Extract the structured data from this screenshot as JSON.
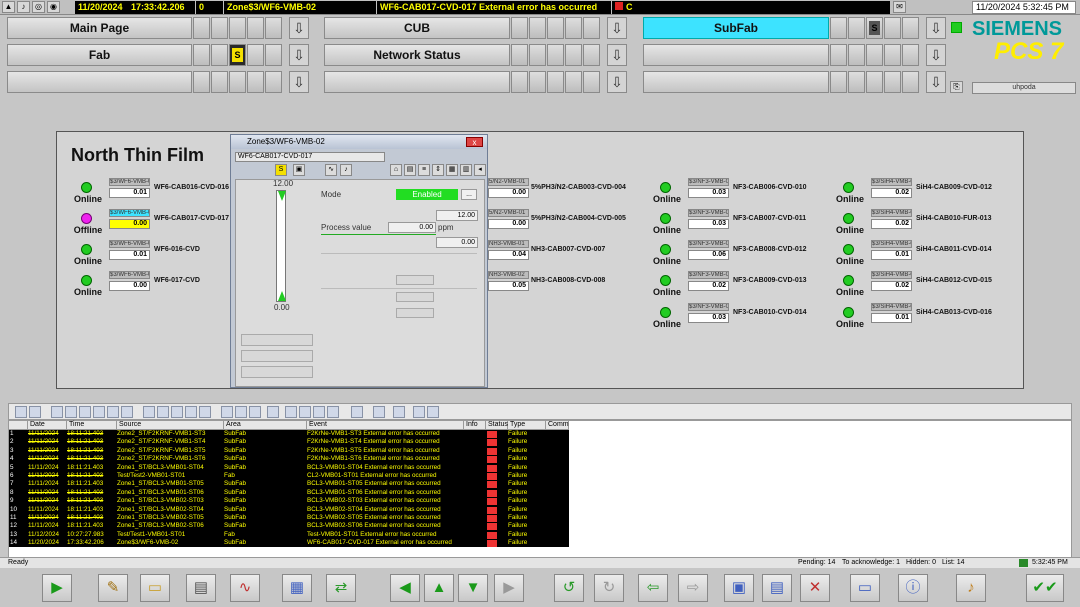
{
  "topbar": {
    "date": "11/20/2024",
    "time": "17:33:42.206",
    "count": "0",
    "source": "Zone$3/WF6-VMB-02",
    "message": "WF6-CAB017-CVD-017 External error has occurred",
    "class": "C",
    "datetime": "11/20/2024 5:32:45 PM"
  },
  "areas": {
    "main_page": "Main Page",
    "cub": "CUB",
    "subfab": "SubFab",
    "fab": "Fab",
    "network_status": "Network Status",
    "s_label": "S"
  },
  "brand": {
    "siemens": "SIEMENS",
    "pcs7": "PCS 7",
    "user": "uhpoda"
  },
  "picture": {
    "title": "North Thin Film",
    "col1": [
      {
        "state": "Online",
        "tag": "$3/WF6-VMB-0",
        "value": "0.01",
        "name": "WF6-CAB016-CVD-016",
        "led": "green"
      },
      {
        "state": "Offline",
        "tag": "$3/WF6-VMB-0",
        "value": "0.00",
        "name": "WF6-CAB017-CVD-017",
        "led": "magenta"
      },
      {
        "state": "Online",
        "tag": "$3/WF6-VMB-0",
        "value": "0.01",
        "name": "WF6-016-CVD",
        "led": "green"
      },
      {
        "state": "Online",
        "tag": "$3/WF6-VMB-0",
        "value": "0.00",
        "name": "WF6-017-CVD",
        "led": "green"
      }
    ],
    "col2": [
      {
        "tag": "5/N2-VMB-01",
        "value": "0.00",
        "name": "5%PH3/N2-CAB003-CVD-004"
      },
      {
        "tag": "5/N2-VMB-01",
        "value": "0.00",
        "name": "5%PH3/N2-CAB004-CVD-005"
      },
      {
        "tag": "NH3-VMB-01",
        "value": "0.04",
        "name": "NH3-CAB007-CVD-007"
      },
      {
        "tag": "NH3-VMB-02",
        "value": "0.05",
        "name": "NH3-CAB008-CVD-008"
      }
    ],
    "col3": [
      {
        "state": "Online",
        "tag": "$3/NF3-VMB-01",
        "value": "0.03",
        "name": "NF3-CAB006-CVD-010"
      },
      {
        "state": "Online",
        "tag": "$3/NF3-VMB-02",
        "value": "0.03",
        "name": "NF3-CAB007-CVD-011"
      },
      {
        "state": "Online",
        "tag": "$3/NF3-VMB-03",
        "value": "0.06",
        "name": "NF3-CAB008-CVD-012"
      },
      {
        "state": "Online",
        "tag": "$3/NF3-VMB-04",
        "value": "0.02",
        "name": "NF3-CAB009-CVD-013"
      },
      {
        "state": "Online",
        "tag": "$3/NF3-VMB-05",
        "value": "0.03",
        "name": "NF3-CAB010-CVD-014"
      }
    ],
    "col4": [
      {
        "state": "Online",
        "tag": "$3/SiH4-VMB-01",
        "value": "0.02",
        "name": "SiH4-CAB009-CVD-012"
      },
      {
        "state": "Online",
        "tag": "$3/SiH4-VMB-02",
        "value": "0.02",
        "name": "SiH4-CAB010-FUR-013"
      },
      {
        "state": "Online",
        "tag": "$3/SiH4-VMB-03",
        "value": "0.01",
        "name": "SiH4-CAB011-CVD-014"
      },
      {
        "state": "Online",
        "tag": "$3/SiH4-VMB-04",
        "value": "0.02",
        "name": "SiH4-CAB012-CVD-015"
      },
      {
        "state": "Online",
        "tag": "$3/SiH4-VMB-05",
        "value": "0.01",
        "name": "SiH4-CAB013-CVD-016"
      }
    ]
  },
  "faceplate": {
    "title": "Zone$3/WF6-VMB-02",
    "tag": "WF6-CAB017-CVD-017",
    "bar_top": "12.00",
    "bar_bottom": "0.00",
    "mode_label": "Mode",
    "mode_value": "Enabled",
    "mode_btn": "...",
    "high_limit": "12.00",
    "pv_label": "Process value",
    "pv_value": "0.00",
    "pv_unit": "ppm",
    "low_limit": "0.00",
    "close": "x"
  },
  "alarm_list": {
    "headers": {
      "date": "Date",
      "time": "Time",
      "source": "Source",
      "area": "Area",
      "event": "Event",
      "info": "Info",
      "status": "Status",
      "type": "Type",
      "comment": "Comm"
    },
    "rows": [
      {
        "n": "1",
        "date": "11/11/2024",
        "time": "18:11:21.403",
        "source": "Zone2_ST/F2KRNF-VMB1-ST3",
        "area": "SubFab",
        "event": "F2KrNe-VMB1-ST3 External error has occurred",
        "type": "Failure",
        "struck": true
      },
      {
        "n": "2",
        "date": "11/11/2024",
        "time": "18:11:21.403",
        "source": "Zone2_ST/F2KRNF-VMB1-ST4",
        "area": "SubFab",
        "event": "F2KrNe-VMB1-ST4 External error has occurred",
        "type": "Failure",
        "struck": true
      },
      {
        "n": "3",
        "date": "11/11/2024",
        "time": "18:11:21.403",
        "source": "Zone2_ST/F2KRNF-VMB1-ST5",
        "area": "SubFab",
        "event": "F2KrNe-VMB1-ST5 External error has occurred",
        "type": "Failure",
        "struck": true
      },
      {
        "n": "4",
        "date": "11/11/2024",
        "time": "18:11:21.403",
        "source": "Zone2_ST/F2KRNF-VMB1-ST6",
        "area": "SubFab",
        "event": "F2KrNe-VMB1-ST6 External error has occurred",
        "type": "Failure",
        "struck": true
      },
      {
        "n": "5",
        "date": "11/11/2024",
        "time": "18:11:21.403",
        "source": "Zone1_ST/BCL3-VMB01-ST04",
        "area": "SubFab",
        "event": "BCL3-VMB01-ST04 External error has occurred",
        "type": "Failure",
        "struck": false
      },
      {
        "n": "6",
        "date": "11/11/2024",
        "time": "18:11:21.403",
        "source": "Test/Test2-VMB01-ST01",
        "area": "Fab",
        "event": "CL2-VMB01-ST01 External error has occurred",
        "type": "Failure",
        "struck": true
      },
      {
        "n": "7",
        "date": "11/11/2024",
        "time": "18:11:21.403",
        "source": "Zone1_ST/BCL3-VMB01-ST05",
        "area": "SubFab",
        "event": "BCL3-VMB01-ST05 External error has occurred",
        "type": "Failure",
        "struck": false
      },
      {
        "n": "8",
        "date": "11/11/2024",
        "time": "18:11:21.403",
        "source": "Zone1_ST/BCL3-VMB01-ST06",
        "area": "SubFab",
        "event": "BCL3-VMB01-ST06 External error has occurred",
        "type": "Failure",
        "struck": true
      },
      {
        "n": "9",
        "date": "11/11/2024",
        "time": "18:11:21.403",
        "source": "Zone1_ST/BCL3-VMB02-ST03",
        "area": "SubFab",
        "event": "BCL3-VMB02-ST03 External error has occurred",
        "type": "Failure",
        "struck": true
      },
      {
        "n": "10",
        "date": "11/11/2024",
        "time": "18:11:21.403",
        "source": "Zone1_ST/BCL3-VMB02-ST04",
        "area": "SubFab",
        "event": "BCL3-VMB02-ST04 External error has occurred",
        "type": "Failure",
        "struck": false
      },
      {
        "n": "11",
        "date": "11/11/2024",
        "time": "18:11:21.403",
        "source": "Zone1_ST/BCL3-VMB02-ST05",
        "area": "SubFab",
        "event": "BCL3-VMB02-ST05 External error has occurred",
        "type": "Failure",
        "struck": true
      },
      {
        "n": "12",
        "date": "11/11/2024",
        "time": "18:11:21.403",
        "source": "Zone1_ST/BCL3-VMB02-ST06",
        "area": "SubFab",
        "event": "BCL3-VMB02-ST06 External error has occurred",
        "type": "Failure",
        "struck": false
      },
      {
        "n": "13",
        "date": "11/12/2024",
        "time": "10:27:27.983",
        "source": "Test/Test1-VMB01-ST01",
        "area": "Fab",
        "event": "Test-VMB01-ST01 External error has occurred",
        "type": "Failure",
        "struck": false
      },
      {
        "n": "14",
        "date": "11/20/2024",
        "time": "17:33:42.206",
        "source": "Zone$3/WF6-VMB-02",
        "area": "SubFab",
        "event": "WF6-CAB017-CVD-017 External error has occurred",
        "type": "Failure",
        "struck": false
      }
    ]
  },
  "statusline": {
    "ready": "Ready",
    "pending": "Pending: 14",
    "to_ack": "To acknowledge: 1",
    "hidden": "Hidden: 0",
    "list": "List: 14",
    "time": "5:32:45 PM"
  }
}
